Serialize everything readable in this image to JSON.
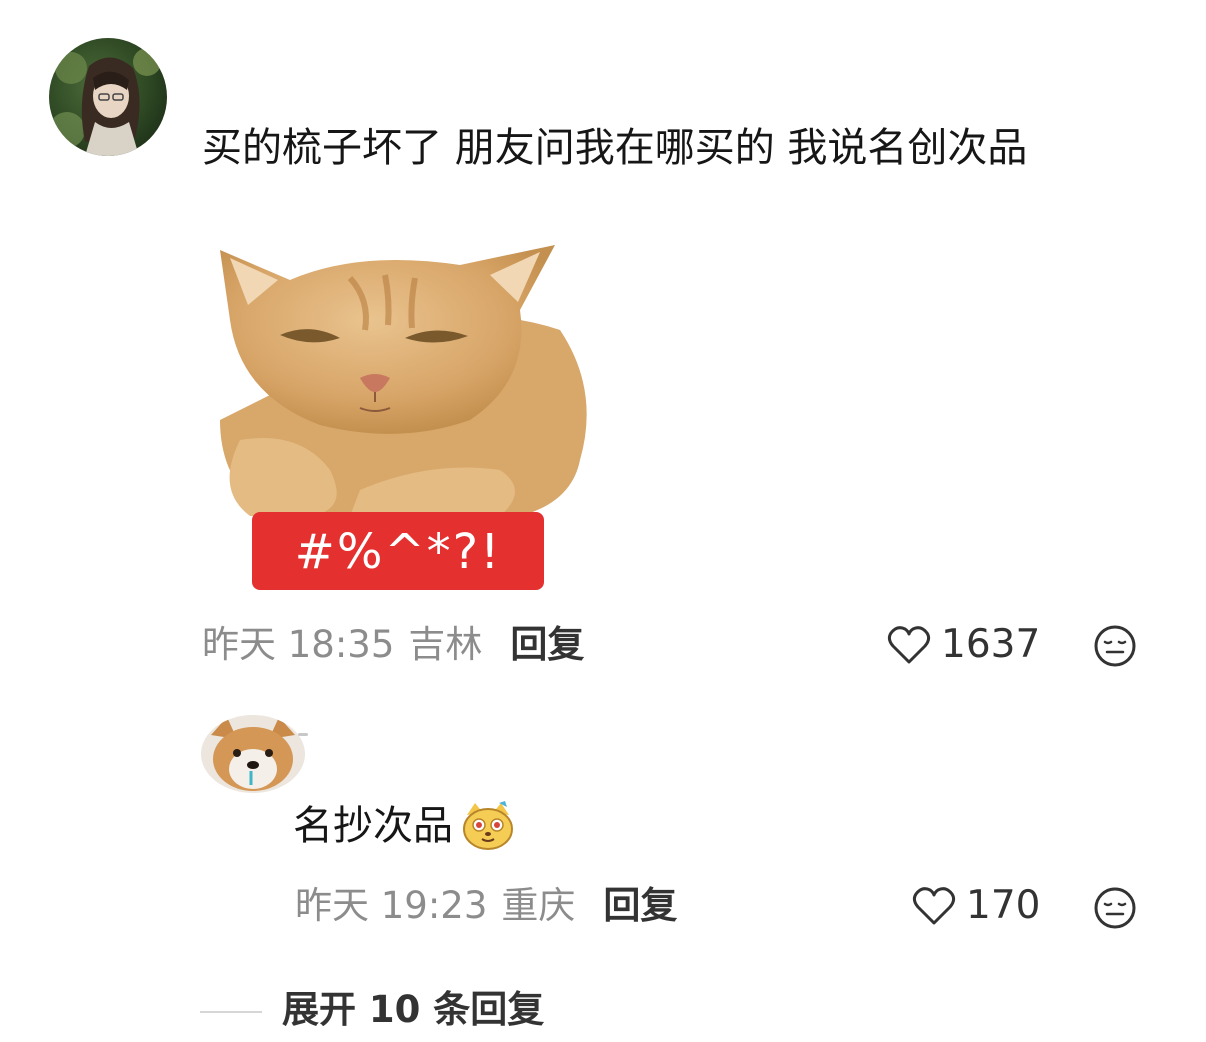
{
  "comment": {
    "text": "买的梳子坏了 朋友问我在哪买的 我说名创次品",
    "sticker_text": "#%^*?!",
    "time": "昨天 18:35",
    "location": "吉林",
    "reply_label": "回复",
    "likes": "1637",
    "avatar_icon": "user-avatar-illustrated",
    "like_icon": "heart-outline-icon",
    "emoji_icon": "neutral-face-icon"
  },
  "reply": {
    "text": "名抄次品",
    "emoji_icon": "doge-face-emoji",
    "time": "昨天 19:23",
    "location": "重庆",
    "reply_label": "回复",
    "likes": "170",
    "avatar_icon": "shiba-dog-avatar"
  },
  "expand": {
    "label": "展开 10 条回复"
  },
  "colors": {
    "meta_gray": "#8c8c8c",
    "text_dark": "#161616",
    "sticker_red": "#e53030"
  }
}
